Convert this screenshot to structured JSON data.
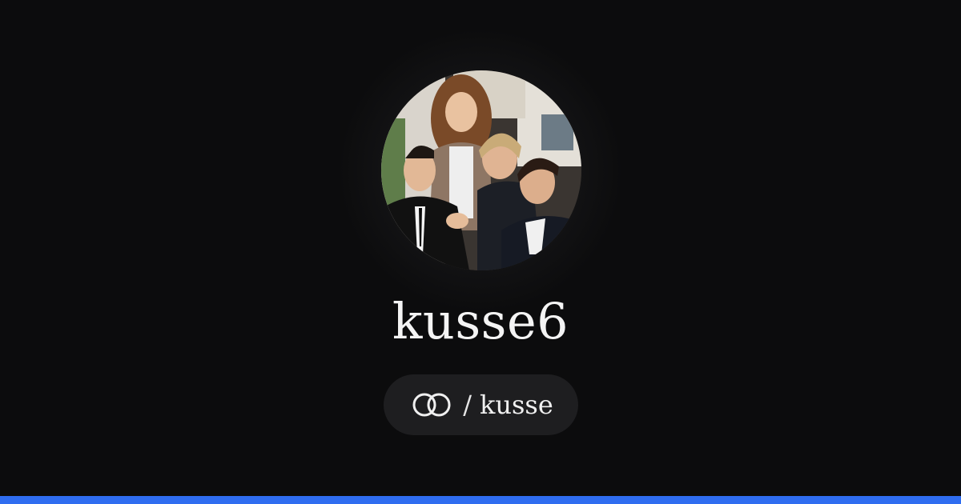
{
  "profile": {
    "username": "kusse6",
    "handle_separator": "/",
    "handle": "kusse",
    "avatar_alt": "profile-photo"
  },
  "icons": {
    "handle_icon": "linked-rings-icon"
  },
  "colors": {
    "background": "#0c0c0d",
    "pill_background": "#1e1e20",
    "accent_bar": "#2f6df0",
    "text": "#f4f4f4"
  }
}
